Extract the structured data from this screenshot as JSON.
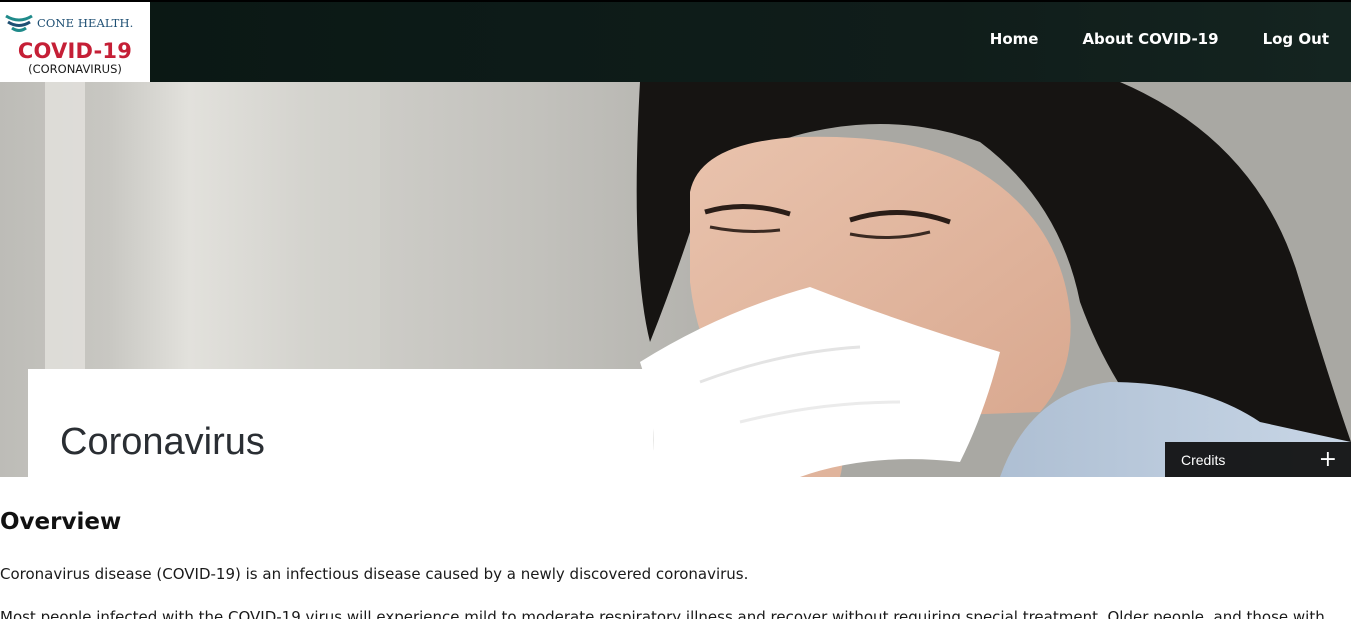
{
  "header": {
    "logo": {
      "brand": "CONE HEALTH.",
      "title": "COVID-19",
      "subtitle": "(CORONAVIRUS)"
    },
    "nav": [
      {
        "label": "Home"
      },
      {
        "label": "About COVID-19"
      },
      {
        "label": "Log Out"
      }
    ]
  },
  "hero": {
    "title": "Coronavirus",
    "credits_label": "Credits",
    "credits_icon": "plus-icon"
  },
  "main": {
    "heading": "Overview",
    "paragraphs": [
      "Coronavirus disease (COVID-19) is an infectious disease caused by a newly discovered coronavirus.",
      "Most people infected with the COVID-19 virus will experience mild to moderate respiratory illness and recover without requiring special treatment. Older people, and those with"
    ]
  },
  "colors": {
    "header_bg": "#0d1b18",
    "brand_blue": "#1e4f73",
    "logo_red": "#c51f36",
    "credits_bg": "#0c0c0c"
  }
}
